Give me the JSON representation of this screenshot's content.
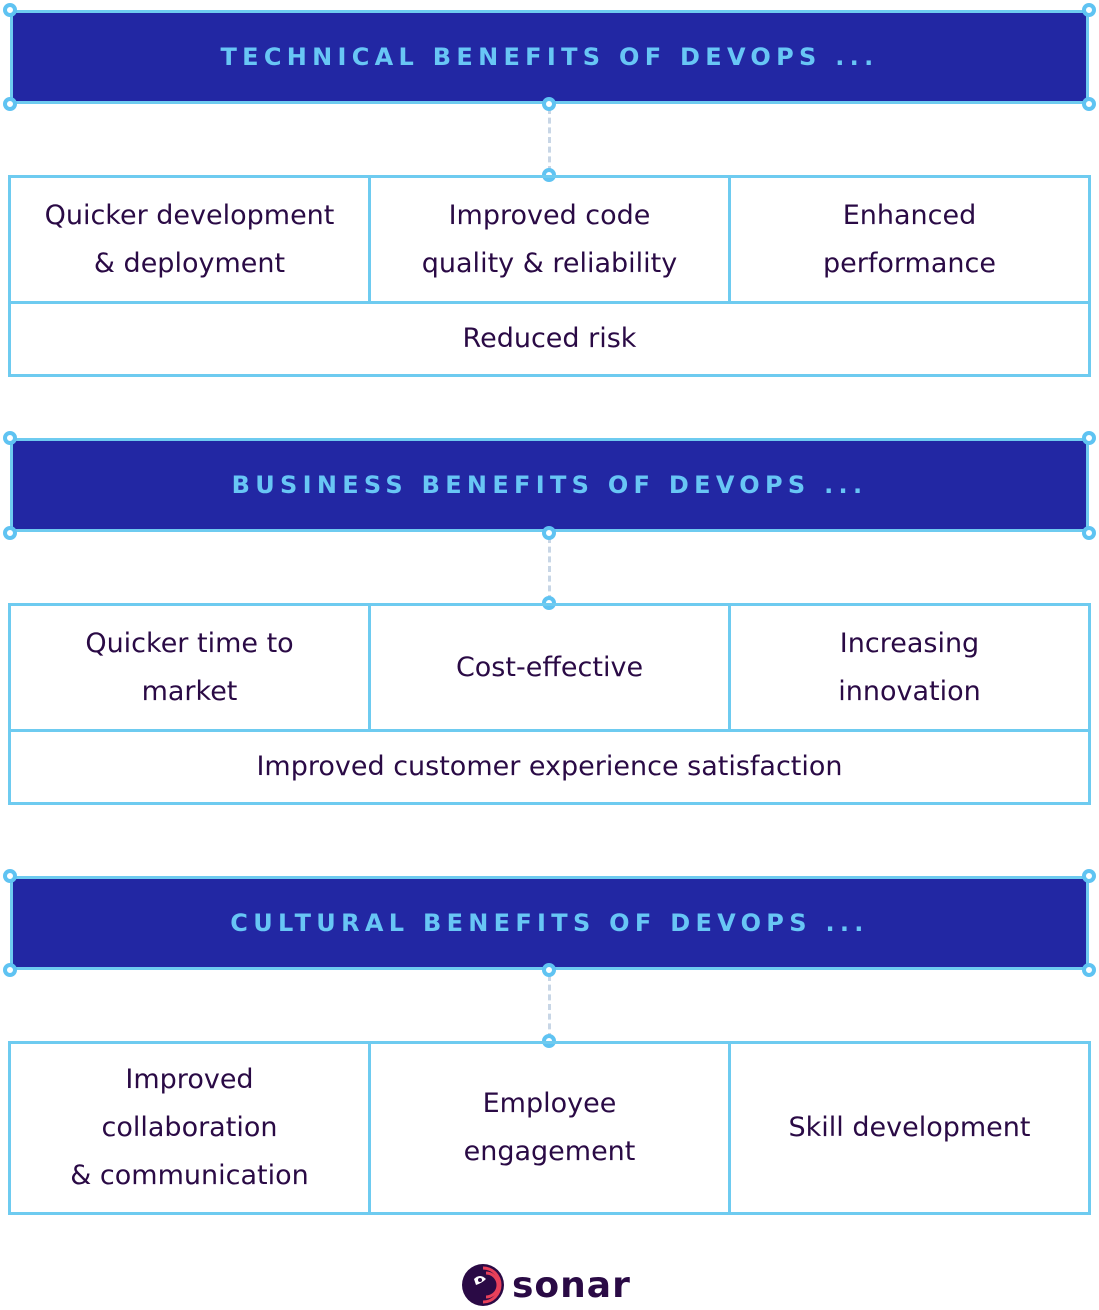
{
  "sections": [
    {
      "title": "TECHNICAL BENEFITS OF DEVOPS ...",
      "top_row": [
        "Quicker development\n& deployment",
        "Improved code\nquality & reliability",
        "Enhanced\nperformance"
      ],
      "bottom_row": "Reduced risk"
    },
    {
      "title": "BUSINESS BENEFITS OF DEVOPS ...",
      "top_row": [
        "Quicker time to\nmarket",
        "Cost-effective",
        "Increasing\ninnovation"
      ],
      "bottom_row": "Improved customer experience satisfaction"
    },
    {
      "title": "CULTURAL BENEFITS OF DEVOPS ...",
      "top_row": [
        "Improved\ncollaboration\n& communication",
        "Employee\nengagement",
        "Skill development"
      ]
    }
  ],
  "logo": {
    "text": "sonar",
    "icon": "sonar-logo-icon"
  },
  "colors": {
    "header_fill": "#2227a3",
    "header_text": "#68c6f5",
    "border": "#6ecbf0",
    "body_text": "#2a0a45",
    "logo_accent": "#e8405a"
  }
}
